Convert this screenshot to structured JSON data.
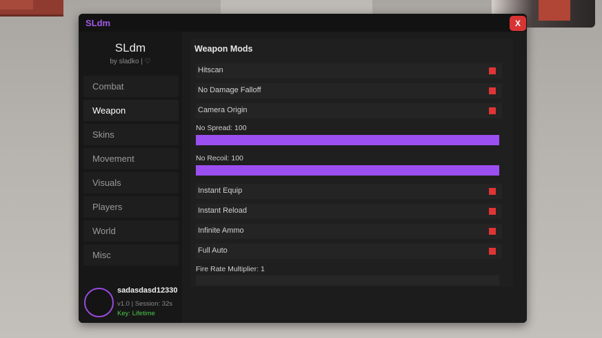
{
  "window": {
    "title": "SLdm",
    "close_label": "X"
  },
  "sidebar": {
    "brand_title": "SLdm",
    "brand_subtitle": "by sladko | ♡",
    "items": [
      {
        "label": "Combat",
        "active": false
      },
      {
        "label": "Weapon",
        "active": true
      },
      {
        "label": "Skins",
        "active": false
      },
      {
        "label": "Movement",
        "active": false
      },
      {
        "label": "Visuals",
        "active": false
      },
      {
        "label": "Players",
        "active": false
      },
      {
        "label": "World",
        "active": false
      },
      {
        "label": "Misc",
        "active": false
      }
    ],
    "profile": {
      "username": "sadasdasd12330",
      "session": "v1.0 | Session: 32s",
      "key": "Key: Lifetime"
    }
  },
  "panel": {
    "title": "Weapon Mods",
    "toggles_top": [
      {
        "label": "Hitscan",
        "enabled": true
      },
      {
        "label": "No Damage Falloff",
        "enabled": true
      },
      {
        "label": "Camera Origin",
        "enabled": true
      }
    ],
    "sliders": [
      {
        "label": "No Spread: 100",
        "fill": 1.0
      },
      {
        "label": "No Recoil: 100",
        "fill": 1.0
      }
    ],
    "toggles_bottom": [
      {
        "label": "Instant Equip",
        "enabled": true
      },
      {
        "label": "Instant Reload",
        "enabled": true
      },
      {
        "label": "Infinite Ammo",
        "enabled": true
      },
      {
        "label": "Full Auto",
        "enabled": true
      }
    ],
    "fire_rate": {
      "label": "Fire Rate Multiplier: 1",
      "fill": 0.0
    }
  },
  "colors": {
    "accent": "#9b4ff0",
    "toggle_on": "#e03535",
    "close": "#d93434",
    "key_text": "#4cc94c"
  }
}
